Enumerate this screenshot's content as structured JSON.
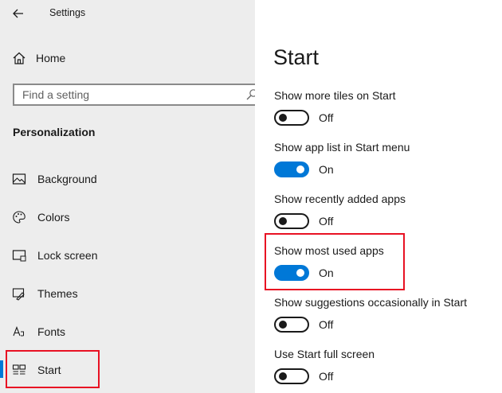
{
  "window": {
    "title": "Settings"
  },
  "sidebar": {
    "home_label": "Home",
    "search_placeholder": "Find a setting",
    "section_title": "Personalization",
    "items": [
      {
        "label": "Background",
        "icon": "picture-icon"
      },
      {
        "label": "Colors",
        "icon": "palette-icon"
      },
      {
        "label": "Lock screen",
        "icon": "lock-screen-icon"
      },
      {
        "label": "Themes",
        "icon": "themes-brush-icon"
      },
      {
        "label": "Fonts",
        "icon": "fonts-icon"
      },
      {
        "label": "Start",
        "icon": "start-tiles-icon",
        "selected": true
      }
    ]
  },
  "main": {
    "title": "Start",
    "settings": [
      {
        "label": "Show more tiles on Start",
        "state": "Off",
        "on": false
      },
      {
        "label": "Show app list in Start menu",
        "state": "On",
        "on": true
      },
      {
        "label": "Show recently added apps",
        "state": "Off",
        "on": false
      },
      {
        "label": "Show most used apps",
        "state": "On",
        "on": true,
        "highlighted": true
      },
      {
        "label": "Show suggestions occasionally in Start",
        "state": "Off",
        "on": false
      },
      {
        "label": "Use Start full screen",
        "state": "Off",
        "on": false
      }
    ]
  },
  "colors": {
    "accent": "#0078d7",
    "highlight": "#e81123",
    "sidebar_bg": "#ededed"
  }
}
